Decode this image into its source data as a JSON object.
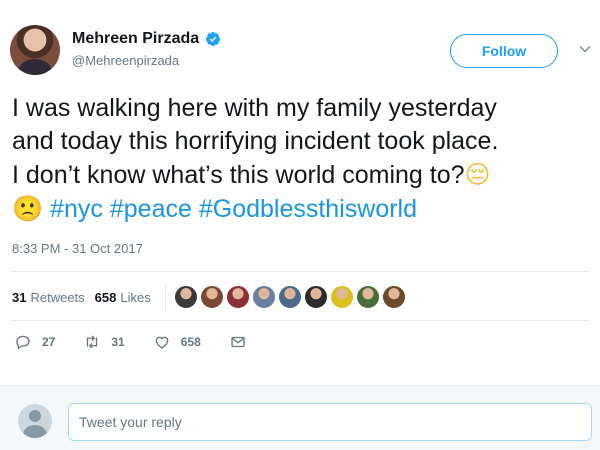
{
  "user": {
    "display_name": "Mehreen Pirzada",
    "handle": "@Mehreenpirzada",
    "verified": true
  },
  "follow_label": "Follow",
  "tweet": {
    "line1": "I was walking here with my family yesterday",
    "line2": "and today this horrifying incident took place.",
    "line3": "I don’t know what’s this world coming to?",
    "emoji_relieved": "😔",
    "emoji_frown": "🙁",
    "hashtags": [
      "#nyc",
      "#peace",
      "#Godblessthisworld"
    ],
    "timestamp": "8:33 PM - 31 Oct 2017"
  },
  "stats": {
    "retweets_count": "31",
    "retweets_label": "Retweets",
    "likes_count": "658",
    "likes_label": "Likes"
  },
  "likers_colors": [
    "#3a3a3a",
    "#7b4a36",
    "#8c2f3a",
    "#6b7fa3",
    "#4c6a8a",
    "#2c2c2c",
    "#d9c21f",
    "#4a6e3a",
    "#6b4a2a"
  ],
  "actions": {
    "reply_count": "27",
    "retweet_count": "31",
    "like_count": "658"
  },
  "reply": {
    "placeholder": "Tweet your reply"
  },
  "colors": {
    "accent": "#1da1f2",
    "hashtag": "#1b95e0",
    "muted": "#657786"
  }
}
